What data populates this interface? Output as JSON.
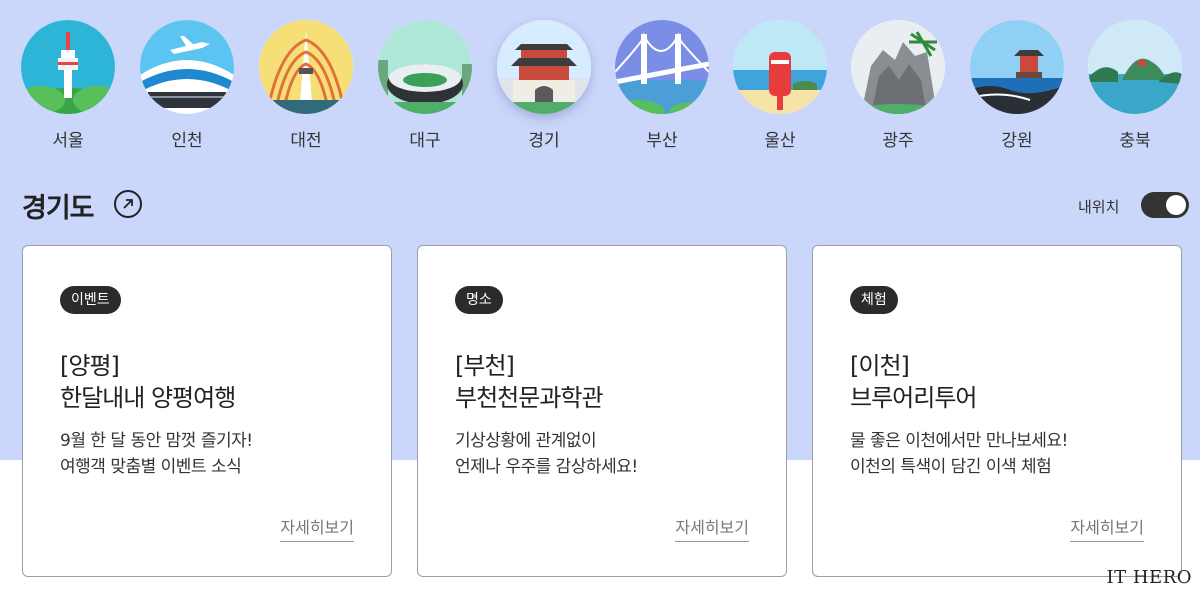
{
  "regions": [
    {
      "label": "서울",
      "icon": "namsan-tower-icon"
    },
    {
      "label": "인천",
      "icon": "airplane-airport-icon"
    },
    {
      "label": "대전",
      "icon": "expo-tower-icon"
    },
    {
      "label": "대구",
      "icon": "stadium-icon"
    },
    {
      "label": "경기",
      "icon": "fortress-gate-icon",
      "active": true
    },
    {
      "label": "부산",
      "icon": "bridge-icon"
    },
    {
      "label": "울산",
      "icon": "postbox-beach-icon"
    },
    {
      "label": "광주",
      "icon": "rock-mountain-icon"
    },
    {
      "label": "강원",
      "icon": "seaside-pavilion-icon"
    },
    {
      "label": "충북",
      "icon": "lake-island-icon"
    }
  ],
  "section": {
    "title": "경기도",
    "link_icon": "arrow-up-right-icon"
  },
  "location_toggle": {
    "label": "내위치",
    "on": true
  },
  "cards": [
    {
      "badge": "이벤트",
      "title_line1": "[양평]",
      "title_line2": "한달내내 양평여행",
      "desc_line1": "9월 한 달 동안 맘껏 즐기자!",
      "desc_line2": "여행객 맞춤별 이벤트 소식",
      "more": "자세히보기"
    },
    {
      "badge": "명소",
      "title_line1": "[부천]",
      "title_line2": "부천천문과학관",
      "desc_line1": "기상상황에 관계없이",
      "desc_line2": "언제나 우주를 감상하세요!",
      "more": "자세히보기"
    },
    {
      "badge": "체험",
      "title_line1": "[이천]",
      "title_line2": "브루어리투어",
      "desc_line1": "물 좋은 이천에서만 만나보세요!",
      "desc_line2": "이천의 특색이 담긴 이색 체험",
      "more": "자세히보기"
    }
  ],
  "watermark": "IT HERO",
  "colors": {
    "band": "#cbd6fb",
    "badge": "#2b2b2b",
    "toggle": "#333333"
  }
}
